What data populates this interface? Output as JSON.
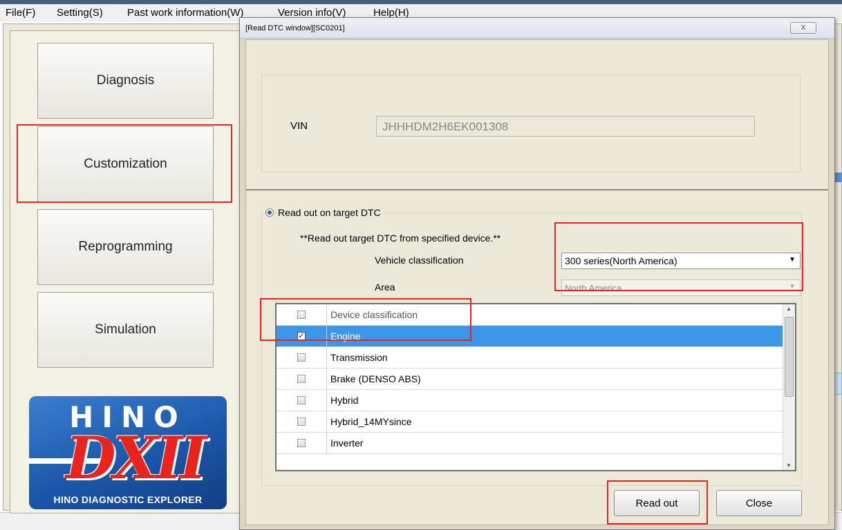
{
  "menu": {
    "items": [
      "File(F)",
      "Setting(S)",
      "Past work information(W)",
      "Version info(V)",
      "Help(H)"
    ]
  },
  "nav": {
    "buttons": [
      "Diagnosis",
      "Customization",
      "Reprogramming",
      "Simulation"
    ]
  },
  "logo": {
    "brand": "HINO",
    "product": "DXII",
    "subtitle": "HINO DIAGNOSTIC EXPLORER"
  },
  "dialog": {
    "title": "[Read DTC window][SC0201]",
    "close_glyph": "X",
    "vin_label": "VIN",
    "vin_value": "JHHHDM2H6EK001308",
    "radio_label": "Read out on target DTC",
    "note": "**Read out target DTC from specified device.**",
    "vehicle_classification_label": "Vehicle classification",
    "vehicle_classification_value": "300 series(North America)",
    "area_label": "Area",
    "area_value": "North America",
    "device_list": {
      "header": "Device classification",
      "rows": [
        {
          "name": "Engine",
          "checked": true,
          "selected": true
        },
        {
          "name": "Transmission",
          "checked": false,
          "selected": false
        },
        {
          "name": "Brake (DENSO ABS)",
          "checked": false,
          "selected": false
        },
        {
          "name": "Hybrid",
          "checked": false,
          "selected": false
        },
        {
          "name": "Hybrid_14MYsince",
          "checked": false,
          "selected": false
        },
        {
          "name": "Inverter",
          "checked": false,
          "selected": false
        }
      ]
    },
    "read_out_button": "Read out",
    "close_button": "Close"
  },
  "colors": {
    "highlight": "#e8231f",
    "selection": "#3d97e6",
    "logo_blue": "#1b57a8",
    "logo_red": "#e8241f"
  }
}
